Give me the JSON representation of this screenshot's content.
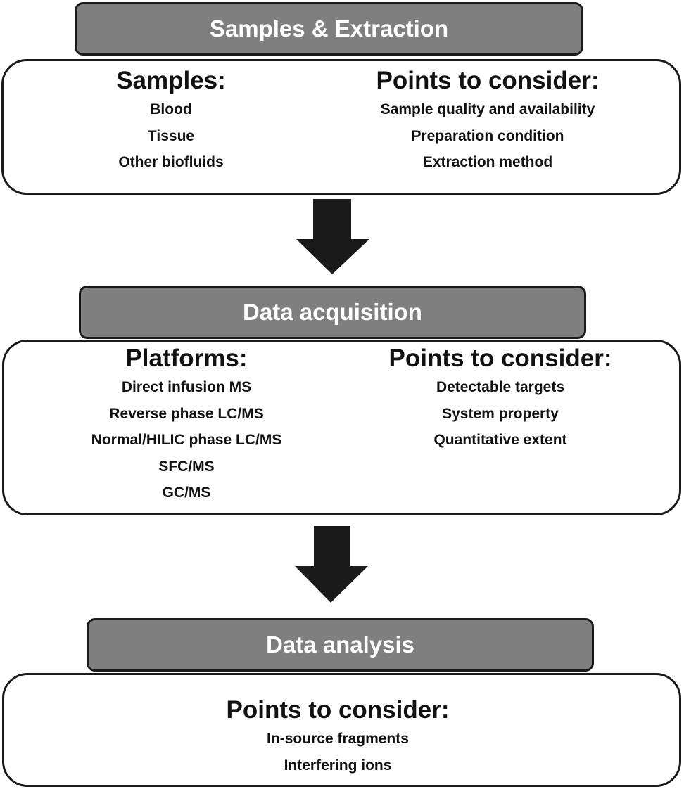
{
  "stages": [
    {
      "title": "Samples & Extraction",
      "left": {
        "heading": "Samples:",
        "items": [
          "Blood",
          "Tissue",
          "Other biofluids"
        ]
      },
      "right": {
        "heading": "Points to consider:",
        "items": [
          "Sample quality and availability",
          "Preparation condition",
          "Extraction method"
        ]
      }
    },
    {
      "title": "Data acquisition",
      "left": {
        "heading": "Platforms:",
        "items": [
          "Direct infusion MS",
          "Reverse phase LC/MS",
          "Normal/HILIC phase LC/MS",
          "SFC/MS",
          "GC/MS"
        ]
      },
      "right": {
        "heading": "Points to consider:",
        "items": [
          "Detectable targets",
          "System property",
          "Quantitative extent"
        ]
      }
    },
    {
      "title": "Data analysis",
      "center": {
        "heading": "Points to consider:",
        "items": [
          "In-source fragments",
          "Interfering ions"
        ]
      }
    }
  ],
  "colors": {
    "header_fill": "#7f7f7f",
    "border": "#1a1a1a",
    "arrow": "#1a1a1a"
  }
}
